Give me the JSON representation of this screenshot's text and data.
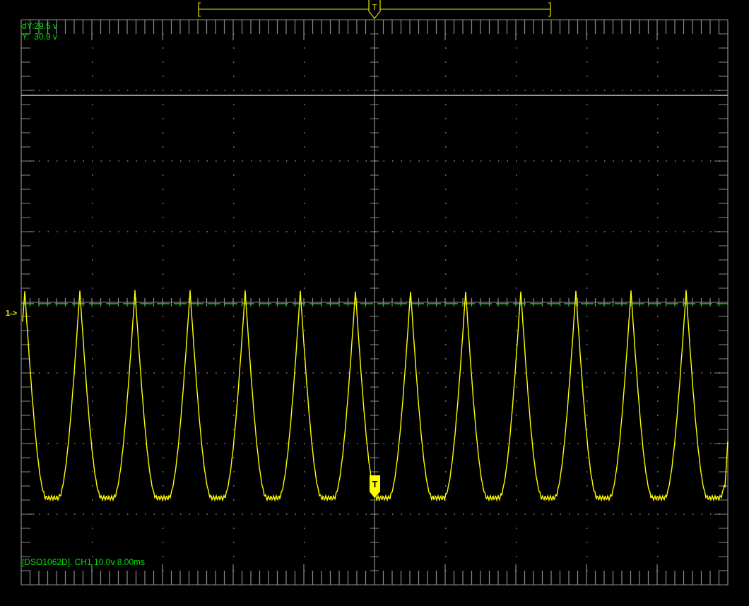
{
  "readouts": [
    "dY:29.5 v",
    "Y:  30.9 v"
  ],
  "channel_marker": "1->",
  "trigger_position_marker": "T",
  "trigger_marker": "T",
  "status_line": "[DSO1062D]. CH1 10.0v 8.00ms"
}
